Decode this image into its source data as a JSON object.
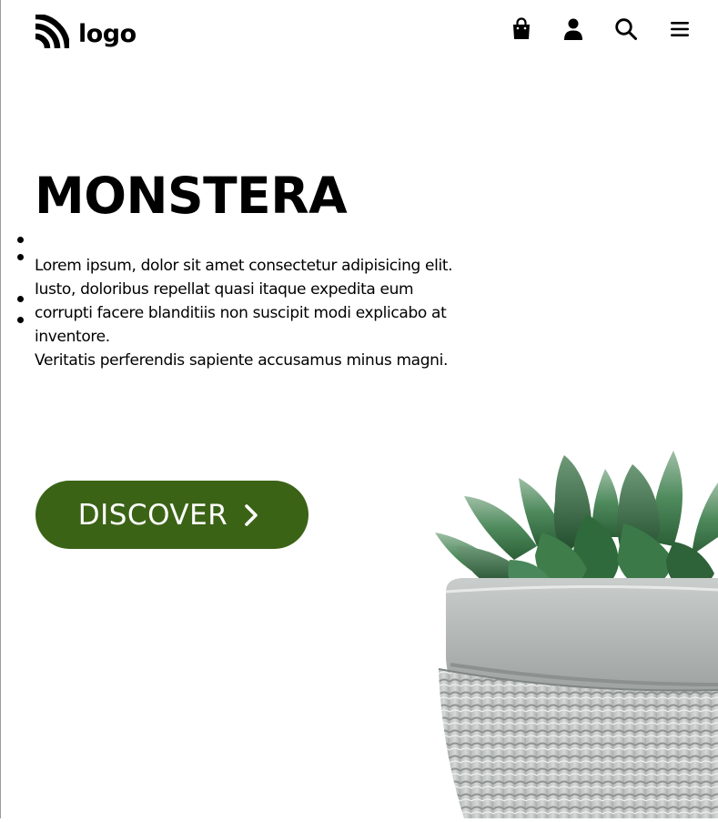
{
  "header": {
    "logo_text": "logo",
    "icons": [
      "shopping-bag-icon",
      "user-icon",
      "search-icon",
      "menu-icon"
    ]
  },
  "hero": {
    "title": "MONSTERA",
    "description_lines": [
      "Lorem ipsum, dolor sit amet consectetur adipisicing elit.",
      "Iusto, doloribus repellat quasi itaque expedita eum",
      "corrupti facere blanditiis non suscipit modi explicabo at",
      "inventore.",
      "Veritatis perferendis sapiente accusamus minus magni."
    ],
    "cta_label": "DISCOVER"
  },
  "colors": {
    "accent": "#3b6316",
    "background": "#ffffff",
    "text": "#000000"
  }
}
